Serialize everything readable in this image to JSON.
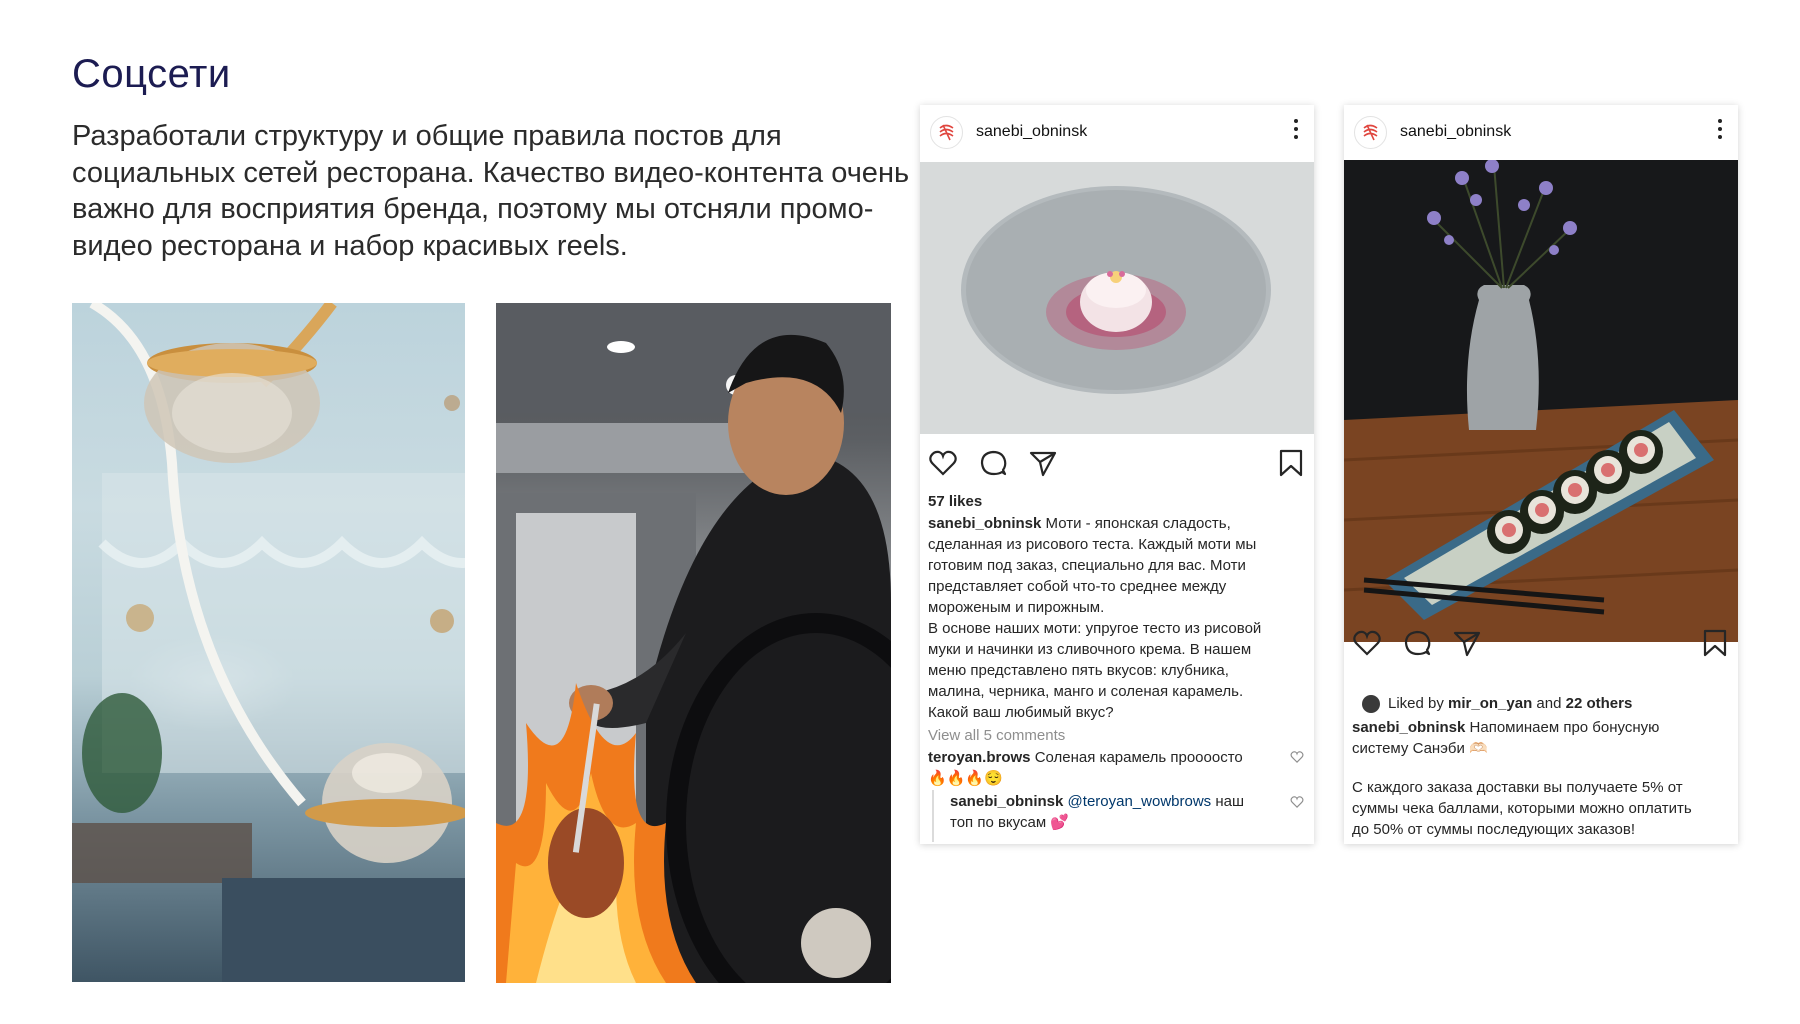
{
  "title": "Соцсети",
  "description": "Разработали структуру и общие правила постов для социальных сетей ресторана. Качество видео-контента очень важно для восприятия бренда, поэтому мы отсняли промо-видео ресторана и набор красивых reels.",
  "post1": {
    "username": "sanebi_obninsk",
    "likes": "57 likes",
    "caption_user": "sanebi_obninsk",
    "caption_lines": [
      "Моти - японская сладость,",
      "сделанная из рисового теста. Каждый моти мы",
      "готовим под заказ, специально для вас. Моти",
      "представляет собой что-то среднее между",
      "мороженым и пирожным.",
      "В основе наших моти: упругое тесто из рисовой",
      "муки и начинки из сливочного крема. В нашем",
      "меню представлено пять вкусов: клубника,",
      "малина, черника, манго и соленая карамель.",
      "Какой ваш любимый вкус?"
    ],
    "view_comments": "View all 5 comments",
    "comment1_user": "teroyan.brows",
    "comment1_text": "Соленая карамель проооосто",
    "comment1_emoji": "🔥🔥🔥😌",
    "reply_user": "sanebi_obninsk",
    "reply_mention": "@teroyan_wowbrows",
    "reply_text": "наш",
    "reply_text2": "топ по вкусам 💕"
  },
  "post2": {
    "username": "sanebi_obninsk",
    "liked_prefix": "Liked by",
    "liked_user": "mir_on_yan",
    "liked_and": "and",
    "liked_others": "22 others",
    "caption_user": "sanebi_obninsk",
    "caption_1": "Напоминаем про бонусную",
    "caption_2": "систему Санэби 🫶🏻",
    "caption_3": "С каждого заказа доставки вы получаете 5% от",
    "caption_4": "суммы чека баллами, которыми можно оплатить",
    "caption_5": "до 50% от суммы последующих заказов!"
  }
}
